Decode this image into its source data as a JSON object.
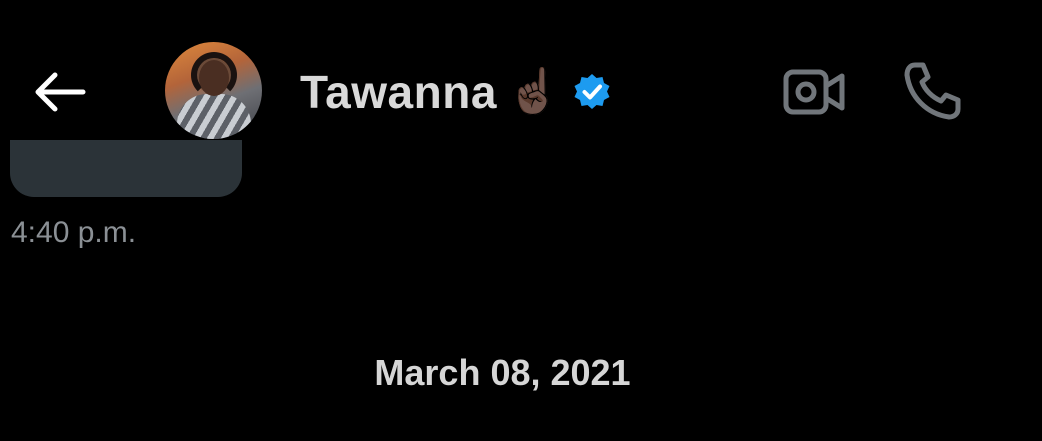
{
  "header": {
    "back_icon": "arrow-left-icon",
    "contact_name": "Tawanna",
    "emoji": "☝🏿",
    "verified_icon": "verified-badge-icon",
    "video_icon": "video-call-icon",
    "call_icon": "phone-call-icon"
  },
  "messages": {
    "last_timestamp": "4:40 p.m."
  },
  "date_separator": "March 08, 2021",
  "colors": {
    "background": "#000000",
    "bubble": "#2b3338",
    "verified": "#1d9bf0",
    "icon_gray": "#71767b",
    "text": "#d9d9d9"
  }
}
